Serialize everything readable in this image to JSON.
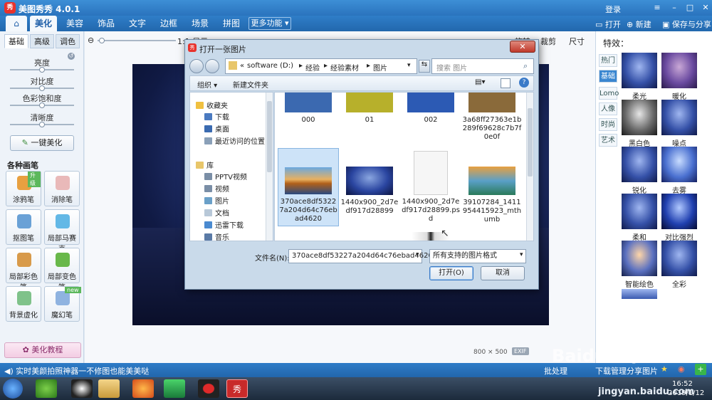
{
  "app": {
    "logo_glyph": "秀",
    "title": "美图秀秀 4.0.1",
    "login": "登录",
    "win_min": "–",
    "win_max": "□",
    "win_close": "✕"
  },
  "tabs": [
    {
      "label": "美化"
    },
    {
      "label": "美容"
    },
    {
      "label": "饰品"
    },
    {
      "label": "文字"
    },
    {
      "label": "边框"
    },
    {
      "label": "场景"
    },
    {
      "label": "拼图"
    }
  ],
  "more_tab": "更多功能 ▾",
  "topright": {
    "open": "打开",
    "new": "新建",
    "save": "保存与分享"
  },
  "left": {
    "subtabs": [
      "基础",
      "高级",
      "调色"
    ],
    "adjust": [
      {
        "label": "亮度",
        "value": 0.5
      },
      {
        "label": "对比度",
        "value": 0.5
      },
      {
        "label": "色彩饱和度",
        "value": 0.5
      },
      {
        "label": "清晰度",
        "value": 0.5
      }
    ],
    "one_click": "一键美化",
    "brush_header": "各种画笔",
    "tools": [
      {
        "label": "涂鸦笔",
        "badge": "升级"
      },
      {
        "label": "消除笔",
        "badge": ""
      },
      {
        "label": "抠图笔",
        "badge": ""
      },
      {
        "label": "局部马赛克",
        "badge": ""
      },
      {
        "label": "局部彩色笔",
        "badge": ""
      },
      {
        "label": "局部变色笔",
        "badge": ""
      },
      {
        "label": "背景虚化",
        "badge": ""
      },
      {
        "label": "魔幻笔",
        "badge": "new"
      }
    ],
    "tutorial": "美化教程"
  },
  "canvas": {
    "zoom_label": "1:1 显示",
    "rotate": "旋转",
    "crop": "裁剪",
    "size": "尺寸",
    "dims": "800 × 500",
    "exif": "EXIF",
    "batch": "批处理"
  },
  "right": {
    "title": "特效：",
    "categories": [
      "热门",
      "基础",
      "Lomo",
      "人像",
      "时尚",
      "艺术"
    ],
    "active_category": "基础",
    "effects": [
      "柔光",
      "暖化",
      "黑白色",
      "噪点",
      "锐化",
      "去雾",
      "柔和",
      "对比强烈",
      "智能绘色",
      "全彩"
    ]
  },
  "status": {
    "tip": "实时美颜拍照神器一不修图也能美美哒",
    "download": "下载管理",
    "share": "分享图片"
  },
  "taskbar": {
    "time": "16:52",
    "date": "2019/1/12"
  },
  "watermark": {
    "brand": "Baidu 经验",
    "url": "jingyan.baidu.com"
  },
  "dialog": {
    "title": "打开一张图片",
    "close": "✕",
    "path": [
      "software (D:)",
      "经验",
      "经验素材",
      "图片"
    ],
    "search_placeholder": "搜索 图片",
    "organize": "组织 ▾",
    "new_folder": "新建文件夹",
    "nav": {
      "favorites": "收藏夹",
      "fav_items": [
        "下载",
        "桌面",
        "最近访问的位置"
      ],
      "libraries": "库",
      "lib_items": [
        "PPTV视频",
        "视频",
        "图片",
        "文档",
        "迅雷下载",
        "音乐"
      ]
    },
    "files": [
      {
        "name": "000",
        "thumb": "#3b69b0"
      },
      {
        "name": "01",
        "thumb": "#b7b02b"
      },
      {
        "name": "002",
        "thumb": "#2c5ab4"
      },
      {
        "name": "3a68ff27363e1b289f69628c7b7f0e0f",
        "thumb": "#8a6a3a"
      },
      {
        "name": "370ace8df53227a204d64c76ebad4620",
        "thumb": "#d08a30"
      },
      {
        "name": "1440x900_2d7edf917d28899",
        "thumb": "#2a45a0"
      },
      {
        "name": "1440x900_2d7edf917d28899.psd",
        "thumb": "#f2f2f2"
      },
      {
        "name": "39107284_1411954415923_mthumb",
        "thumb": "#3a8fb8"
      }
    ],
    "filename_label": "文件名(N):",
    "filename_value": "370ace8df53227a204d64c76ebad4620",
    "filter_value": "所有支持的图片格式",
    "open_button": "打开(O)",
    "cancel_button": "取消"
  }
}
